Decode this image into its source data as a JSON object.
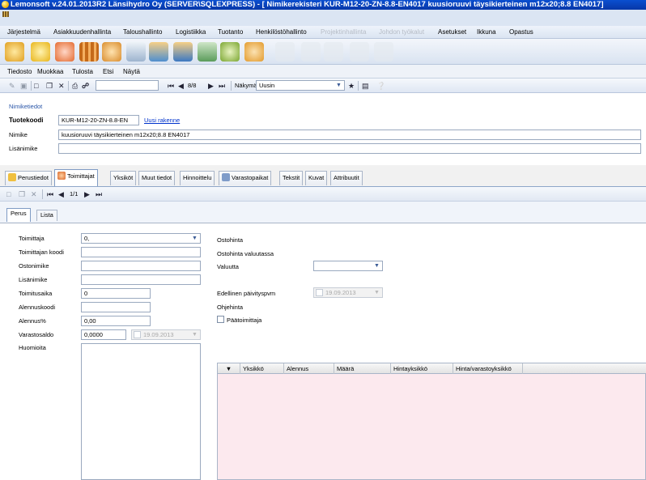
{
  "window": {
    "title": "Lemonsoft v.24.01.2013R2 Länsihydro Oy (SERVER\\SQLEXPRESS) - [ Nimikerekisteri KUR-M12-20-ZN-8.8-EN4017 kuusioruuvi täysikierteinen m12x20;8.8 EN4017]"
  },
  "main_menu": [
    {
      "label": "Järjestelmä",
      "enabled": true
    },
    {
      "label": "Asiakkuudenhallinta",
      "enabled": true
    },
    {
      "label": "Taloushallinto",
      "enabled": true
    },
    {
      "label": "Logistiikka",
      "enabled": true
    },
    {
      "label": "Tuotanto",
      "enabled": true
    },
    {
      "label": "Henkilöstöhallinto",
      "enabled": true
    },
    {
      "label": "Projektinhallinta",
      "enabled": false
    },
    {
      "label": "Johdon työkalut",
      "enabled": false
    },
    {
      "label": "Asetukset",
      "enabled": true
    },
    {
      "label": "Ikkuna",
      "enabled": true
    },
    {
      "label": "Opastus",
      "enabled": true
    }
  ],
  "module_icons": [
    "tools-icon",
    "folder-icon",
    "people-icon",
    "boxes-icon",
    "stack-icon",
    "document-icon",
    "truck-in-icon",
    "truck-out-icon",
    "factory-icon",
    "globe-icon",
    "gear-icon",
    "car-icon",
    "chart-icon",
    "network-icon",
    "book-icon",
    "chess-icon"
  ],
  "doc_menu": [
    {
      "label": "Tiedosto"
    },
    {
      "label": "Muokkaa"
    },
    {
      "label": "Tulosta"
    },
    {
      "label": "Etsi"
    },
    {
      "label": "Näytä"
    }
  ],
  "navbar": {
    "record": "8/8",
    "view_label": "Näkymä",
    "view_value": "Uusin"
  },
  "header": {
    "section_title": "Nimiketiedot",
    "tuotekoodi_label": "Tuotekoodi",
    "tuotekoodi_value": "KUR-M12-20-ZN-8.8-EN",
    "new_structure_link": "Uusi rakenne",
    "nimike_label": "Nimike",
    "nimike_value": "kuusioruuvi täysikierteinen m12x20;8.8 EN4017",
    "lisanimike_label": "Lisänimike",
    "lisanimike_value": ""
  },
  "tabs": [
    {
      "label": "Perustiedot",
      "icon": "folder-icon"
    },
    {
      "label": "Toimittajat",
      "icon": "supplier-icon"
    },
    {
      "label": "Yksiköt",
      "icon": ""
    },
    {
      "label": "Muut tiedot",
      "icon": ""
    },
    {
      "label": "Hinnoittelu",
      "icon": ""
    },
    {
      "label": "Varastopaikat",
      "icon": "warehouse-icon"
    },
    {
      "label": "Tekstit",
      "icon": ""
    },
    {
      "label": "Kuvat",
      "icon": ""
    },
    {
      "label": "Attribuutit",
      "icon": ""
    }
  ],
  "subnav": {
    "record": "1/1"
  },
  "inner_tabs": [
    {
      "label": "Perus"
    },
    {
      "label": "Lista"
    }
  ],
  "form": {
    "toimittaja_label": "Toimittaja",
    "toimittaja_value": "0,",
    "toimittajan_koodi_label": "Toimittajan koodi",
    "toimittajan_koodi_value": "",
    "ostonimike_label": "Ostonimike",
    "ostonimike_value": "",
    "lisanimike_label": "Lisänimike",
    "lisanimike_value": "",
    "toimitusaika_label": "Toimitusaika",
    "toimitusaika_value": "0",
    "alennuskoodi_label": "Alennuskoodi",
    "alennuskoodi_value": "",
    "alennus_label": "Alennus%",
    "alennus_value": "0,00",
    "varastosaldo_label": "Varastosaldo",
    "varastosaldo_value": "0,0000",
    "varastosaldo_date": "19.09.2013",
    "huomioita_label": "Huomioita",
    "ostohinta_label": "Ostohinta",
    "ostohinta_valuutassa_label": "Ostohinta valuutassa",
    "valuutta_label": "Valuutta",
    "valuutta_value": "",
    "edellinen_label": "Edellinen päivityspvm",
    "edellinen_value": "19.09.2013",
    "ohjehinta_label": "Ohjehinta",
    "paatoimittaja_label": "Päätoimittaja",
    "paatoimittaja_checked": false
  },
  "grid": {
    "filter_icon": "filter-icon",
    "columns": [
      "Yksikkö",
      "Alennus",
      "Määrä",
      "Hintayksikkö",
      "Hinta/varastoyksikkö"
    ]
  }
}
